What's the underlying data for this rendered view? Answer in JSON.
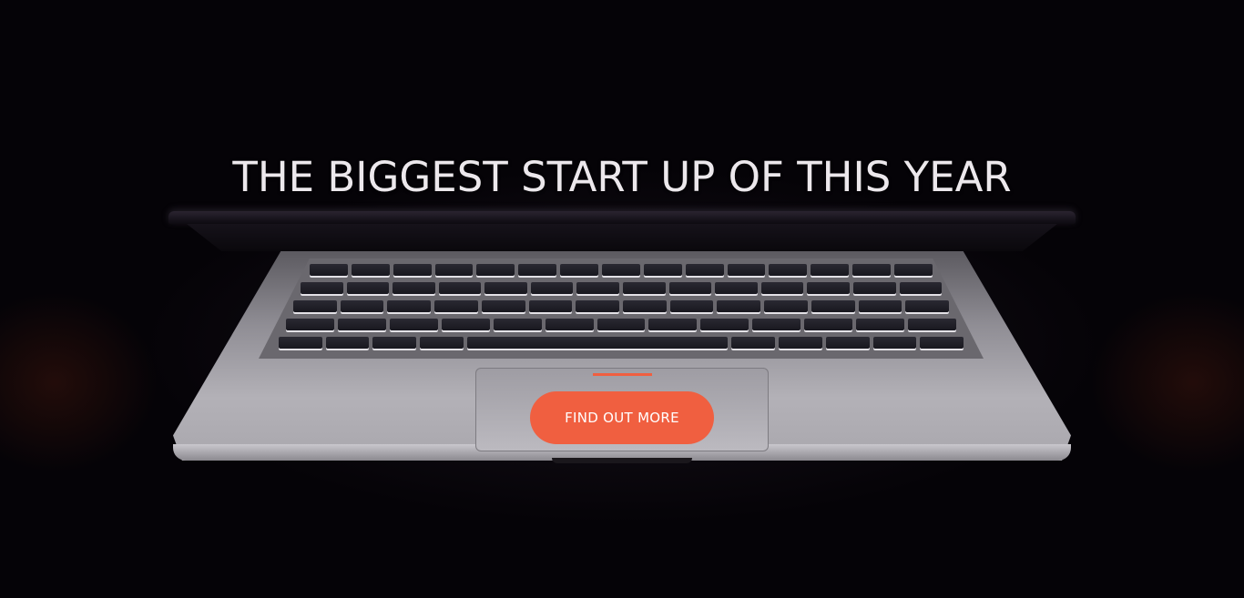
{
  "hero": {
    "title": "THE BIGGEST START UP OF THIS YEAR",
    "cta_label": "FIND OUT MORE",
    "background_image": "laptop-keyboard-dark",
    "accent_color": "#f05f40",
    "title_color": "#ece8ec",
    "background_color": "#050307"
  }
}
